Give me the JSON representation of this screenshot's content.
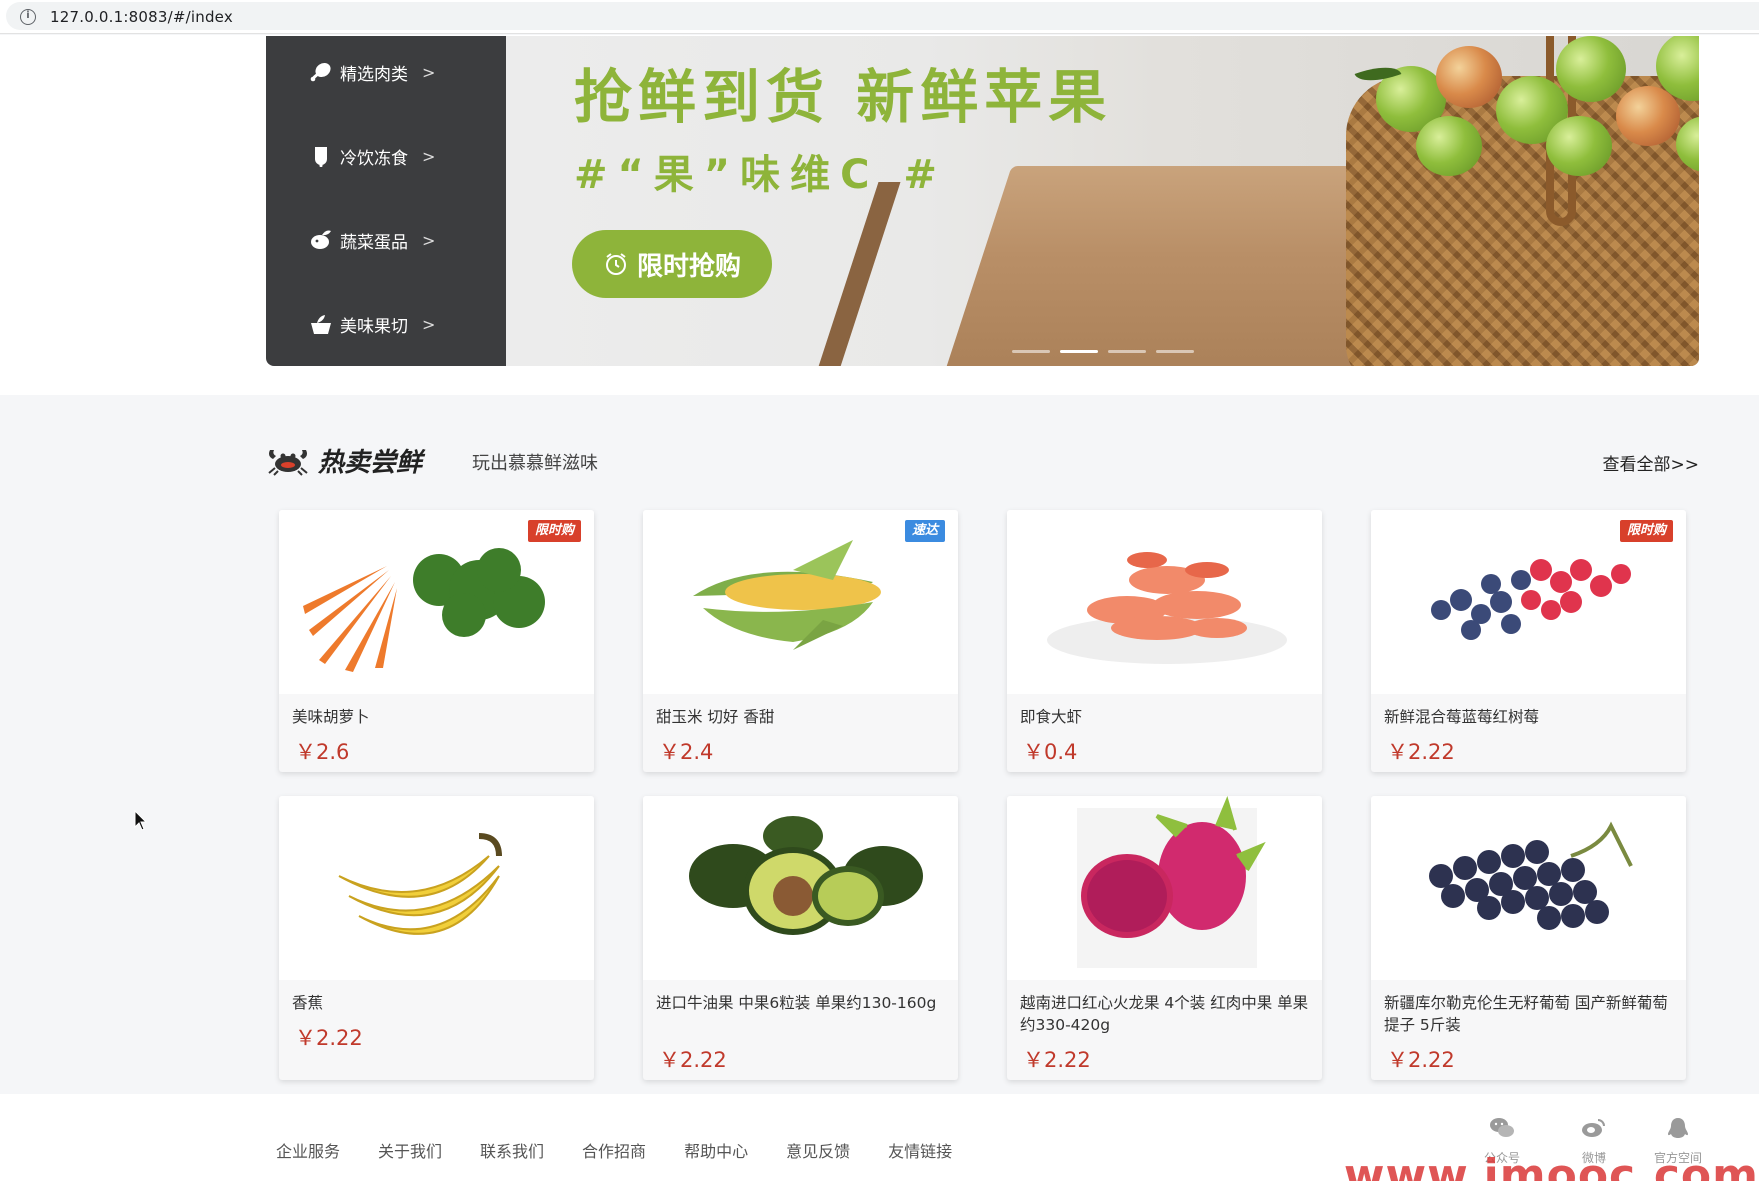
{
  "browser": {
    "url": "127.0.0.1:8083/#/index"
  },
  "categories": [
    {
      "label": "精选肉类",
      "arrow": ">",
      "icon": "drumstick-icon"
    },
    {
      "label": "冷饮冻食",
      "arrow": ">",
      "icon": "popsicle-icon"
    },
    {
      "label": "蔬菜蛋品",
      "arrow": ">",
      "icon": "vegetable-icon"
    },
    {
      "label": "美味果切",
      "arrow": ">",
      "icon": "fruit-bowl-icon"
    }
  ],
  "banner": {
    "title": "抢鲜到货  新鲜苹果",
    "subtitle": "#“果”味维C #",
    "button_label": "限时抢购",
    "slide_count": 4,
    "active_slide": 2
  },
  "section": {
    "title": "热卖尝鲜",
    "subtitle": "玩出慕慕鲜滋味",
    "more_link": "查看全部>>"
  },
  "products": [
    {
      "name": "美味胡萝卜",
      "price": "￥2.6",
      "tag": "限时购",
      "tag_color": "#d8402b"
    },
    {
      "name": "甜玉米 切好 香甜",
      "price": "￥2.4",
      "tag": "速达",
      "tag_color": "#3b8be0"
    },
    {
      "name": "即食大虾",
      "price": "￥0.4",
      "tag": ""
    },
    {
      "name": "新鲜混合莓蓝莓红树莓",
      "price": "￥2.22",
      "tag": "限时购",
      "tag_color": "#d8402b"
    },
    {
      "name": "香蕉",
      "price": "￥2.22",
      "tag": ""
    },
    {
      "name": "进口牛油果 中果6粒装 单果约130-160g",
      "price": "￥2.22",
      "tag": ""
    },
    {
      "name": "越南进口红心火龙果 4个装 红肉中果 单果约330-420g",
      "price": "￥2.22",
      "tag": ""
    },
    {
      "name": "新疆库尔勒克伦生无籽葡萄 国产新鲜葡萄 提子 5斤装",
      "price": "￥2.22",
      "tag": ""
    }
  ],
  "footer": {
    "links": [
      "企业服务",
      "关于我们",
      "联系我们",
      "合作招商",
      "帮助中心",
      "意见反馈",
      "友情链接"
    ],
    "social": [
      {
        "icon": "wechat-icon",
        "label": "公众号"
      },
      {
        "icon": "weibo-icon",
        "label": "微博"
      },
      {
        "icon": "qq-icon",
        "label": "官方空间"
      }
    ],
    "watermark": "www.imooc.com"
  },
  "colors": {
    "accent": "#8eb43a",
    "price": "#c0392b",
    "sidebar": "#3c3d3f"
  }
}
